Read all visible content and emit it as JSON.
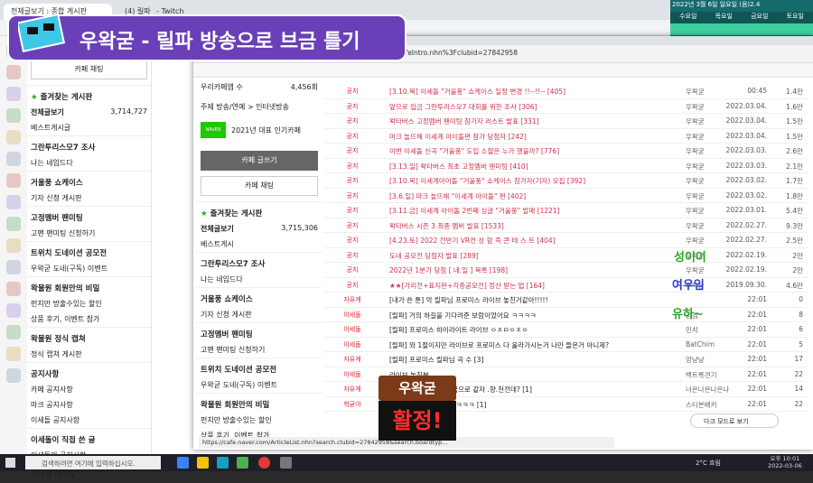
{
  "title_overlay": "우왁굳 - 릴파 방송으로 브금 틀기",
  "back_tabs": [
    "전체글보기 : 종합 게시판",
    "(4) 릴파_ - Twitch"
  ],
  "left_sidebar": {
    "chat_button": "카페 채팅",
    "fav_header": "즐겨찾는 게시판",
    "items": [
      {
        "label": "전체글보기",
        "count": "3,714,727"
      },
      {
        "label": "베스트게시글"
      }
    ],
    "sections": [
      {
        "head": "그란투리스모7 조사",
        "items": [
          "나는 네임드다"
        ]
      },
      {
        "head": "거울풍 쇼케이스",
        "items": [
          "기자 신청 게시판"
        ]
      },
      {
        "head": "고정멤버 팬미팅",
        "items": [
          "고팬 팬미팅 신청하기"
        ]
      },
      {
        "head": "트위치 도네이션 공모전",
        "items": [
          "우왁굳 도네(구독) 이벤트"
        ]
      },
      {
        "head": "왁물원 회원만의 비밀",
        "items": [
          "펀치만 방출수있는 할인",
          "상품 후기, 이벤트 참가"
        ]
      },
      {
        "head": "왁물원 정식 캡쳐",
        "items": [
          "정식 캡쳐 게시판"
        ]
      },
      {
        "head": "공지사항",
        "items": [
          "카페 공지사항",
          "마크 공지사항",
          "이세돌 공지사항"
        ]
      },
      {
        "head": "이세돌이 직접 쓴 글",
        "items": [
          "이세돌의 공지사항"
        ]
      },
      {
        "head": "이세계 아이돌",
        "items": []
      }
    ]
  },
  "front": {
    "url": "cafe.naver.com/steamindiegame?iframe_url=/MyCafeIntro.nhn%3Fclubid=27842958",
    "status_url": "https://cafe.naver.com/ArticleList.nhn?search.clubid=27842958&search.boardtyp...",
    "stats": [
      {
        "label": "우리카페앱 수",
        "value": "4,456회"
      }
    ],
    "theme": "주제  방송/연예 > 인터넷방송",
    "award": "2021년 대표 인기카페",
    "write_button": "카페 글쓰기",
    "chat_button": "카페 채팅",
    "fav_header": "즐겨찾는 게시판",
    "all_posts": "전체글보기",
    "all_count": "3,715,306",
    "best": "베스트게시",
    "sections": [
      {
        "head": "그란투리스모7 조사",
        "items": [
          "나는 네임드다"
        ]
      },
      {
        "head": "거울풍 쇼케이스",
        "items": [
          "기자 신청 게시판"
        ]
      },
      {
        "head": "고정멤버 팬미팅",
        "items": [
          "고팬 팬미팅 신청하기"
        ]
      },
      {
        "head": "트위치 도네이션 공모전",
        "items": [
          "우왁굳 도네(구독) 이벤트"
        ]
      },
      {
        "head": "왁물원 회원만의 비밀",
        "items": [
          "펀치만 방출수있는 할인",
          "상품 후기, 이벤트 참가"
        ]
      }
    ]
  },
  "posts": [
    {
      "badge": "공지",
      "title": "[3.10.목] 이세돌 \"거울풍\" 쇼케이스 일정 변경 !!--!!-- [405]",
      "author": "우왁굳",
      "date": "00:45",
      "views": "1.4만",
      "notice": true
    },
    {
      "badge": "공지",
      "title": "앞으로 입금 그란투리스모7 대회를 위한 조사 [306]",
      "author": "우왁굳",
      "date": "2022.03.04.",
      "views": "1.6만",
      "notice": true
    },
    {
      "badge": "공지",
      "title": "왁타버스 고정멤버 팬미팅 참가자 리스트 발표 [331]",
      "author": "우왁굳",
      "date": "2022.03.04.",
      "views": "1.5만",
      "notice": true
    },
    {
      "badge": "공지",
      "title": "마크 놀뜨해 이세계 아이돌편 참가 당첨자 [242]",
      "author": "우왁굳",
      "date": "2022.03.04.",
      "views": "1.5만",
      "notice": true
    },
    {
      "badge": "공지",
      "title": "이번 이세돌 신곡 \"거울풍\" 도입 소절은 누가 했을까? [776]",
      "author": "우왁굳",
      "date": "2022.03.03.",
      "views": "2.6만",
      "notice": true
    },
    {
      "badge": "공지",
      "title": "[3.13.일] 왁타버스 최초 고정멤버 팬미팅 [410]",
      "author": "우왁굳",
      "date": "2022.03.03.",
      "views": "2.1만",
      "notice": true
    },
    {
      "badge": "공지",
      "title": "[3.10.목] 이세계아이돌 \"거울풍\" 쇼케이스 참가자(기자) 모집 [392]",
      "author": "우왁굳",
      "date": "2022.03.02.",
      "views": "1.7만",
      "notice": true
    },
    {
      "badge": "공지",
      "title": "[3.6.일] 마크 놀뜨해 \"이세계 아이돌\" 편 [402]",
      "author": "우왁굳",
      "date": "2022.03.02.",
      "views": "1.8만",
      "notice": true
    },
    {
      "badge": "공지",
      "title": "[3.11.금] 이세계 아이돌 2번째 싱글 \"거울풍\" 발매 [1221]",
      "author": "우왁굳",
      "date": "2022.03.01.",
      "views": "5.4만",
      "notice": true
    },
    {
      "badge": "공지",
      "title": "왁타버스 시즌 3 최종 멤버 발표 [1533]",
      "author": "우왁굳",
      "date": "2022.02.27.",
      "views": "9.3만",
      "notice": true
    },
    {
      "badge": "공지",
      "title": "[4.23.토] 2022 전반기 VR컨 상 함 즉 콘 테 스 트 [404]",
      "author": "우왁굳",
      "date": "2022.02.27.",
      "views": "2.5만",
      "notice": true
    },
    {
      "badge": "공지",
      "title": "도네 공모전 당첨자 발표 [289]",
      "author": "우왁굳",
      "date": "2022.02.19.",
      "views": "2만",
      "notice": true
    },
    {
      "badge": "공지",
      "title": "2022년 1분기 당첨 [ 네.일 ] 목록 [198]",
      "author": "우왁굳",
      "date": "2022.02.19.",
      "views": "2만",
      "notice": true
    },
    {
      "badge": "공지",
      "title": "★★[가리전+표지판+각종공모전] 정산 받는 법 [164]",
      "author": "우왁굳",
      "date": "2019.09.30.",
      "views": "4.6만",
      "notice": true
    },
    {
      "badge": "자유게",
      "title": "[내가 쓴 툰] 악 릴파님 프로미스 라이브 놓친거같아!!!!!",
      "author": "",
      "date": "22:01",
      "views": "0",
      "notice": false
    },
    {
      "badge": "이세돌",
      "title": "[릴파] 거의 하길을 기다려준 보람이었어요 ㅋㅋㅋㅋ",
      "author": "검검",
      "date": "22:01",
      "views": "8",
      "notice": false
    },
    {
      "badge": "이세돌",
      "title": "[릴파] 프로미스 하이라이트 라이브 ㅇㅈㅁㅇㅈㅇ",
      "author": "민치",
      "date": "22:01",
      "views": "6",
      "notice": false
    },
    {
      "badge": "이세돌",
      "title": "[릴파] 와 1절이지만 라이브로 프로미스 다 올라가시는거 나만 들은거 아니제?",
      "author": "BatChim",
      "date": "22:01",
      "views": "5",
      "notice": false
    },
    {
      "badge": "자유게",
      "title": "[릴파] 프로미스 릴파님 곡 수 [3]",
      "author": "앙냥냥",
      "date": "22:01",
      "views": "17",
      "notice": false
    },
    {
      "badge": "이세돌",
      "title": "라이브 놓친분",
      "author": "백트록견기",
      "date": "22:01",
      "views": "22",
      "notice": false
    },
    {
      "badge": "자유게",
      "title": "돈 릴파님 도방에서 브금으로 같자 .향.천전데? [1]",
      "author": "너은나은나은나",
      "date": "22:01",
      "views": "14",
      "notice": false
    },
    {
      "badge": "왁굳야",
      "title": "장했다 멋어간다 ㅋㅋㅋㅋㅋㅋ [1]",
      "author": "스티븐배커",
      "date": "22:01",
      "views": "22",
      "notice": false
    }
  ],
  "calendar": {
    "header": [
      "수요일",
      "목요일",
      "금요일",
      "토요일"
    ],
    "today": "2022년 3월 6일 일요일 (음)2.4"
  },
  "chat_names": [
    {
      "name": "성이이",
      "color": "#2ea52e"
    },
    {
      "name": "여우임",
      "color": "#2c3fd1"
    },
    {
      "name": "유하~",
      "color": "#2ea52e"
    }
  ],
  "dark_mode": "다크 모드로 보기",
  "streamer_tag": "우왁굳",
  "live_tag": "활정!",
  "taskbar": {
    "search": "검색하려면 여기에 입력하십시오.",
    "time": "오후 10:01",
    "date": "2022-03-06",
    "weather": "2°C 흐림"
  },
  "colors": {
    "purple": "#6a3fb7",
    "notice_red": "#d0304a",
    "teal": "#156b6b"
  }
}
